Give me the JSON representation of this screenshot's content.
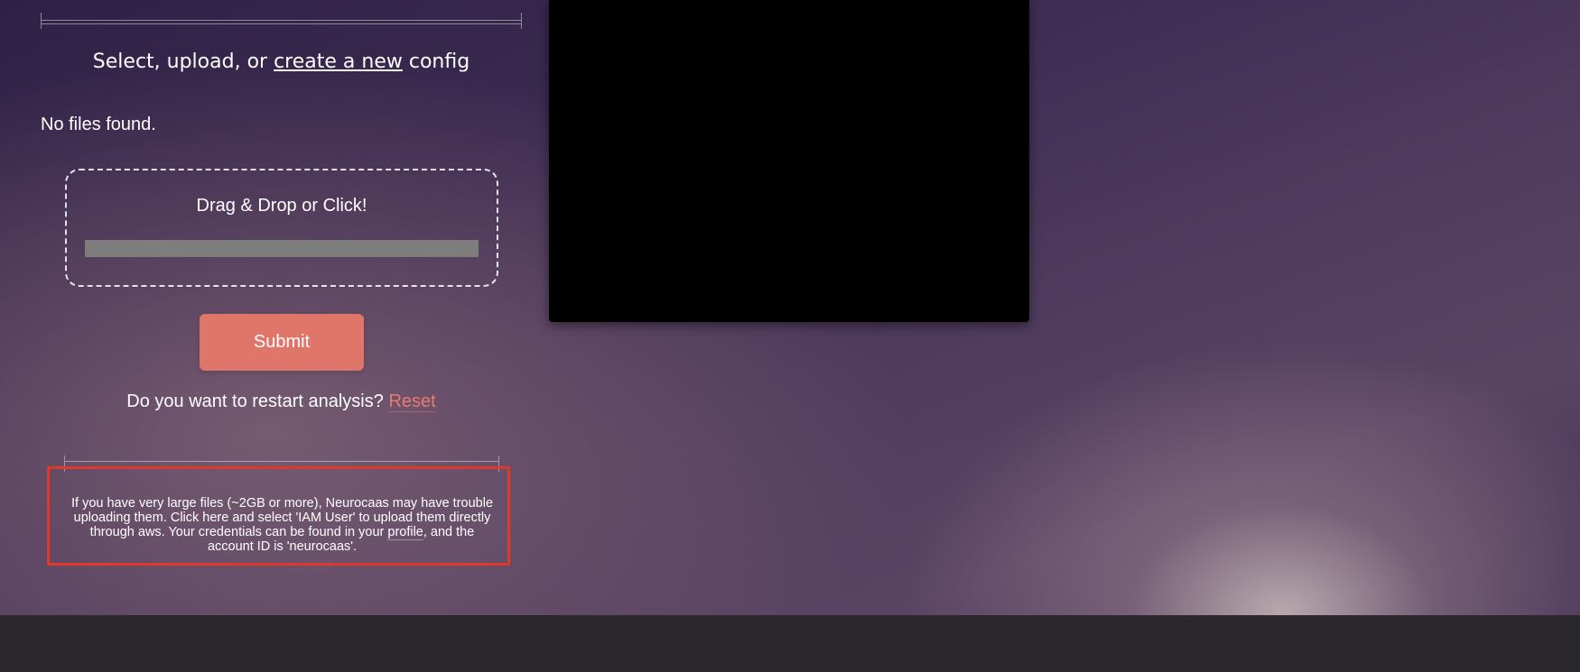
{
  "config_section": {
    "heading_prefix": "Select, upload, or ",
    "heading_link": "create a new",
    "heading_suffix": " config",
    "no_files_text": "No files found."
  },
  "dropzone": {
    "label": "Drag & Drop or Click!",
    "progress_fraction": 0
  },
  "submit": {
    "label": "Submit"
  },
  "restart": {
    "question": "Do you want to restart analysis? ",
    "reset_label": "Reset"
  },
  "notice": {
    "text_part1": "If you have very large files (~2GB or more), Neurocaas may have trouble uploading them. Click here and select 'IAM User' to upload them directly through aws. Your credentials can be found in your ",
    "profile_link": "profile",
    "text_part2": ", and the account ID is 'neurocaas'."
  },
  "colors": {
    "submit_button": "#e0766a",
    "reset_link": "#e87b6f",
    "highlight_box": "#e0382b",
    "footer": "#2a272d",
    "video_panel": "#000000"
  }
}
